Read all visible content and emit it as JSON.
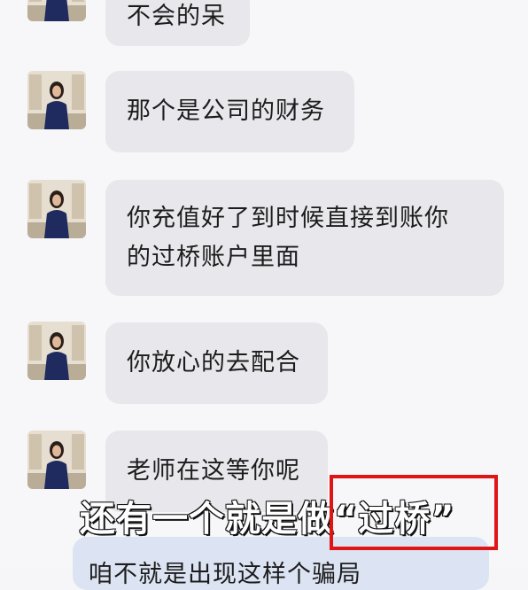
{
  "messages": [
    {
      "text": "不会的呆"
    },
    {
      "text": "那个是公司的财务"
    },
    {
      "text": "你充值好了到时候直接到账你\n的过桥账户里面"
    },
    {
      "text": "你放心的去配合"
    },
    {
      "text": "老师在这等你呢"
    }
  ],
  "bottom_message": {
    "text": "咱不就是出现这样个骗局"
  },
  "caption": {
    "text": "还有一个就是做“过桥”"
  },
  "colors": {
    "bubble": "#e7e7ec",
    "background": "#f7f7f9",
    "highlight": "#e01515"
  },
  "icons": {
    "avatar": "person-avatar-icon"
  }
}
